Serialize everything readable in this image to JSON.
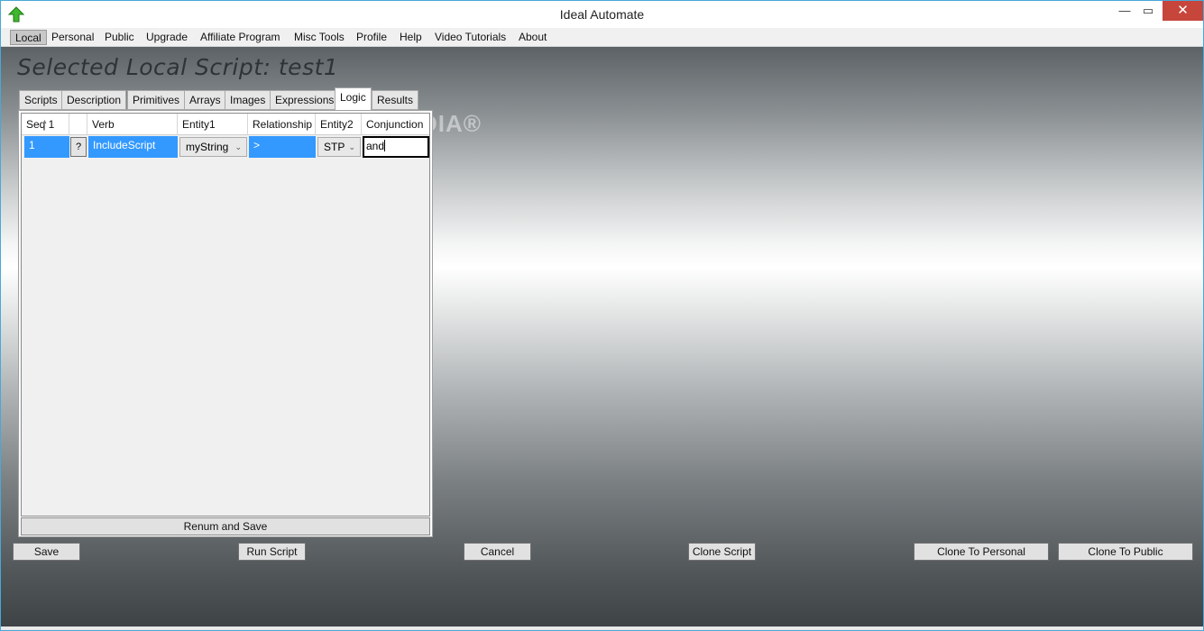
{
  "window": {
    "title": "Ideal Automate",
    "min_glyph": "—",
    "max_glyph": "▭",
    "close_glyph": "✕"
  },
  "menu": [
    "Local",
    "Personal",
    "Public",
    "Upgrade",
    "Affiliate Program",
    "Misc Tools",
    "Profile",
    "Help",
    "Video Tutorials",
    "About"
  ],
  "page_title": "Selected Local Script:  test1",
  "tabs": [
    "Scripts",
    "Description",
    "Primitives",
    "Arrays",
    "Images",
    "Expressions",
    "Logic",
    "Results"
  ],
  "active_tab": "Logic",
  "grid": {
    "columns": [
      "Seq 1",
      "",
      "Verb",
      "Entity1",
      "Relationship",
      "Entity2",
      "Conjunction"
    ],
    "rows": [
      {
        "seq": "1",
        "help": "?",
        "verb": "IncludeScript",
        "entity1": "myString",
        "relationship": ">",
        "entity2": "STP",
        "conjunction": "and"
      }
    ]
  },
  "renum_label": "Renum and Save",
  "watermark": "SOFTPEDIA®",
  "buttons": {
    "save": "Save",
    "run": "Run Script",
    "cancel": "Cancel",
    "clone": "Clone Script",
    "clone_personal": "Clone To Personal",
    "clone_public": "Clone To Public"
  },
  "colors": {
    "selection": "#3399ff",
    "close_button": "#c7463c",
    "app_icon": "#3fb72e"
  }
}
